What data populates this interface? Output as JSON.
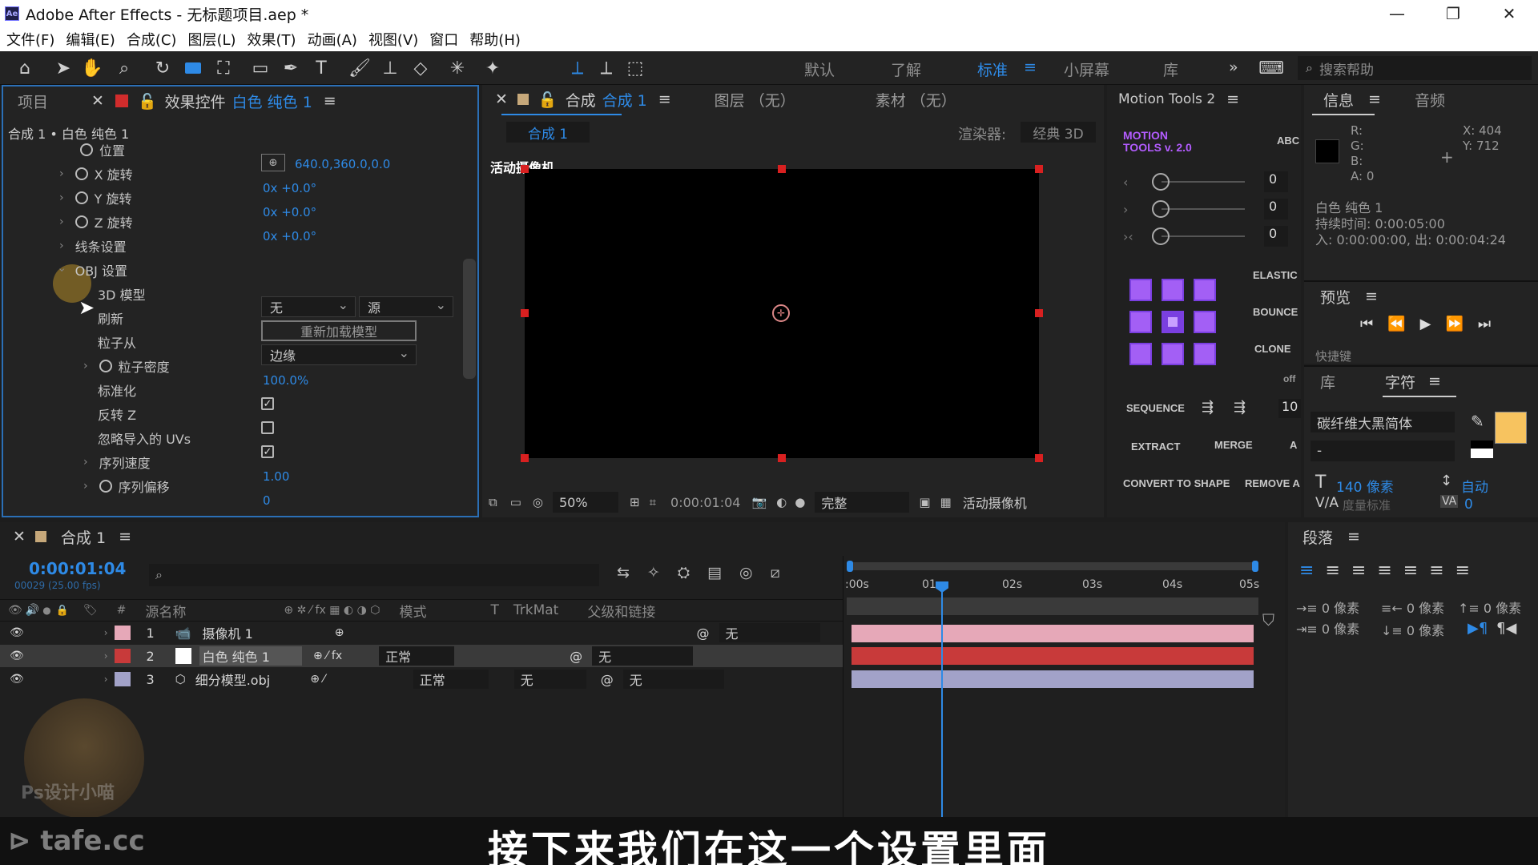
{
  "app": {
    "logo": "Ae",
    "title": "Adobe After Effects - 无标题项目.aep *",
    "window_controls": [
      "—",
      "❐",
      "✕"
    ]
  },
  "menu": [
    "文件(F)",
    "编辑(E)",
    "合成(C)",
    "图层(L)",
    "效果(T)",
    "动画(A)",
    "视图(V)",
    "窗口",
    "帮助(H)"
  ],
  "workspaces": {
    "items": [
      "默认",
      "了解",
      "标准",
      "小屏幕",
      "库"
    ],
    "active": "标准",
    "more": "»",
    "search_placeholder": "搜索帮助"
  },
  "effects_panel": {
    "tab_project": "项目",
    "tab_effects_prefix": "效果控件",
    "tab_effects_layer": "白色 纯色 1",
    "breadcrumb": "合成 1 • 白色 纯色 1",
    "rows": [
      {
        "label": "位置",
        "value": "640.0,360.0,0.0"
      },
      {
        "label": "X 旋转",
        "value": "0x +0.0°"
      },
      {
        "label": "Y 旋转",
        "value": "0x +0.0°"
      },
      {
        "label": "Z 旋转",
        "value": "0x +0.0°"
      },
      {
        "label": "线条设置"
      },
      {
        "label": "OBJ 设置"
      },
      {
        "label": "3D 模型",
        "dropdown1": "无",
        "dropdown2": "源"
      },
      {
        "label": "刷新",
        "button": "重新加载模型"
      },
      {
        "label": "粒子从",
        "dropdown1": "边缘"
      },
      {
        "label": "粒子密度",
        "value": "100.0%"
      },
      {
        "label": "标准化",
        "checked": true
      },
      {
        "label": "反转 Z",
        "checked": false
      },
      {
        "label": "忽略导入的 UVs",
        "checked": true
      },
      {
        "label": "序列速度",
        "value": "1.00"
      },
      {
        "label": "序列偏移",
        "value": "0"
      }
    ]
  },
  "comp_panel": {
    "tab_comp": "合成",
    "tab_comp_name": "合成 1",
    "tab_layer": "图层 （无）",
    "tab_footage": "素材 （无）",
    "sub_tab": "合成 1",
    "renderer_label": "渲染器:",
    "renderer_value": "经典 3D",
    "camera_label": "活动摄像机",
    "zoom": "50%",
    "timecode": "0:00:01:04",
    "quality": "完整",
    "view": "活动摄像机"
  },
  "motion_tools": {
    "title": "Motion Tools 2",
    "logo_line1": "MOTION",
    "logo_line2": "TOOLS v. 2.0",
    "abc": "ABC",
    "sliders": [
      "0",
      "0",
      "0"
    ],
    "labels": [
      "ELASTIC",
      "BOUNCE",
      "CLONE",
      "off",
      "SEQUENCE",
      "EXTRACT",
      "MERGE",
      "A",
      "CONVERT TO SHAPE",
      "REMOVE A"
    ],
    "sequence_value": "10"
  },
  "info_panel": {
    "tab_info": "信息",
    "tab_audio": "音频",
    "r": "R:",
    "g": "G:",
    "b": "B:",
    "a": "A: 0",
    "x": "X: 404",
    "y": "Y: 712",
    "layer_name": "白色 纯色 1",
    "duration": "持续时间: 0:00:05:00",
    "in_out": "入: 0:00:00:00, 出: 0:00:04:24"
  },
  "preview_panel": {
    "title": "预览",
    "shortcut": "快捷键"
  },
  "char_panel": {
    "tab_lib": "库",
    "tab_char": "字符",
    "font": "碳纤维大黑简体",
    "style": "-",
    "size": "140 像素",
    "leading": "自动",
    "tracking_label": "度量标准",
    "kerning": "0",
    "fill_color": "#f7c35f"
  },
  "para_panel": {
    "title": "段落",
    "indent_values": [
      "0 像素",
      "0 像素",
      "0 像素",
      "0 像素",
      "0 像素"
    ]
  },
  "timeline": {
    "tab": "合成 1",
    "timecode": "0:00:01:04",
    "frames": "00029 (25.00 fps)",
    "columns": [
      "源名称",
      "模式",
      "T",
      "TrkMat",
      "父级和链接"
    ],
    "ruler": [
      ":00s",
      "01s",
      "02s",
      "03s",
      "04s",
      "05s"
    ],
    "layers": [
      {
        "num": "1",
        "name": "摄像机 1",
        "mode": "",
        "trkmat": "",
        "parent": "无",
        "color": "#e6a8b8"
      },
      {
        "num": "2",
        "name": "白色 纯色 1",
        "mode": "正常",
        "trkmat": "",
        "parent": "无",
        "color": "#c83a3a"
      },
      {
        "num": "3",
        "name": "细分模型.obj",
        "mode": "正常",
        "trkmat": "无",
        "parent": "无",
        "color": "#a2a2c8"
      }
    ],
    "current_time": 1.16,
    "duration": 5
  },
  "subtitle": "接下来我们在这一个设置里面",
  "watermark": {
    "site": "tafe.cc",
    "author": "Ps设计小喵"
  }
}
